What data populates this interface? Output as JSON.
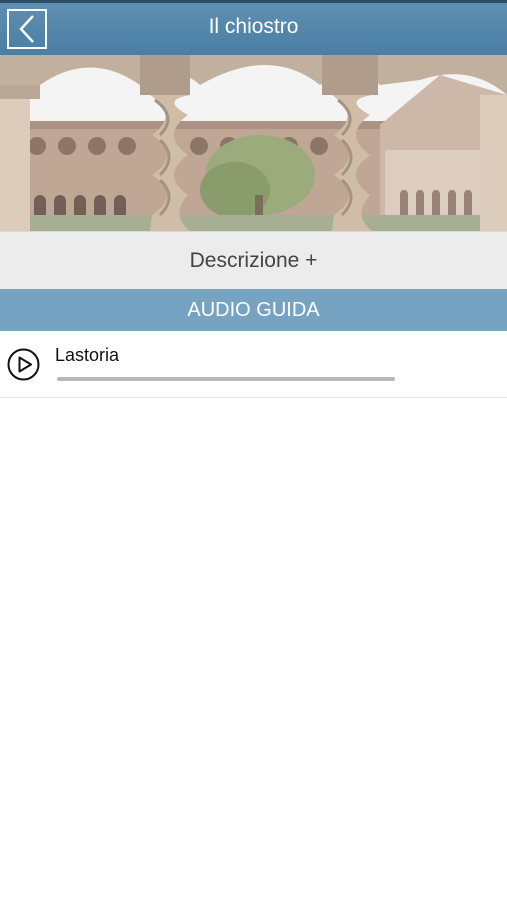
{
  "header": {
    "title": "Il chiostro",
    "back_icon": "chevron-left-icon"
  },
  "hero": {
    "image": "cloister-photo"
  },
  "description": {
    "label": "Descrizione +"
  },
  "audio_section": {
    "label": "AUDIO GUIDA",
    "tracks": [
      {
        "title": "Lastoria",
        "icon": "play-icon",
        "progress": 0
      }
    ]
  },
  "colors": {
    "header_bg": "#4a7ea4",
    "section_bg": "#77a3c3",
    "description_bg": "#ececec"
  }
}
